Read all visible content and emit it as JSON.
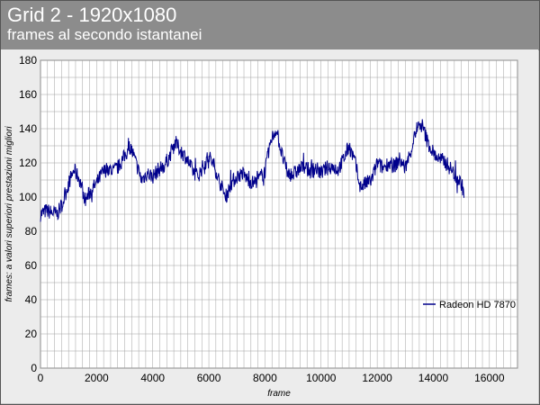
{
  "header": {
    "title": "Grid 2 - 1920x1080",
    "subtitle": "frames al secondo istantanei"
  },
  "colors": {
    "header_bg": "#8c8c8c",
    "plot_bg": "#ffffff",
    "grid": "#a0a0a0",
    "series": "#00008b"
  },
  "chart_data": {
    "type": "line",
    "title": "Grid 2 - 1920x1080",
    "subtitle": "frames al secondo istantanei",
    "xlabel": "frame",
    "ylabel": "frames: a valori superiori prestazioni migliori",
    "xlim": [
      0,
      17000
    ],
    "ylim": [
      0,
      180
    ],
    "xticks": [
      "0",
      "2000",
      "4000",
      "6000",
      "8000",
      "10000",
      "12000",
      "14000",
      "16000"
    ],
    "yticks": [
      "0",
      "20",
      "40",
      "60",
      "80",
      "100",
      "120",
      "140",
      "160",
      "180"
    ],
    "grid": true,
    "legend_position": "right",
    "series": [
      {
        "name": "Radeon HD 7870",
        "color": "#00008b",
        "x": [
          0,
          200,
          400,
          600,
          800,
          1000,
          1200,
          1400,
          1600,
          1800,
          2000,
          2200,
          2400,
          2600,
          2800,
          3000,
          3200,
          3400,
          3600,
          3800,
          4000,
          4200,
          4400,
          4600,
          4800,
          5000,
          5200,
          5400,
          5600,
          5800,
          6000,
          6200,
          6400,
          6600,
          6800,
          7000,
          7200,
          7400,
          7600,
          7800,
          8000,
          8200,
          8400,
          8600,
          8800,
          9000,
          9200,
          9400,
          9600,
          9800,
          10000,
          10200,
          10400,
          10600,
          10800,
          11000,
          11200,
          11400,
          11600,
          11800,
          12000,
          12200,
          12400,
          12600,
          12800,
          13000,
          13200,
          13400,
          13600,
          13800,
          14000,
          14200,
          14400,
          14600,
          14800,
          15000,
          15100
        ],
        "values": [
          90,
          92,
          91,
          90,
          97,
          108,
          116,
          110,
          98,
          104,
          108,
          114,
          117,
          115,
          118,
          124,
          130,
          120,
          110,
          114,
          112,
          116,
          118,
          124,
          132,
          127,
          123,
          116,
          112,
          118,
          124,
          118,
          108,
          100,
          108,
          112,
          114,
          110,
          108,
          111,
          115,
          132,
          140,
          125,
          114,
          113,
          116,
          118,
          115,
          117,
          114,
          117,
          118,
          116,
          122,
          130,
          121,
          106,
          108,
          110,
          120,
          117,
          120,
          118,
          122,
          117,
          127,
          140,
          142,
          132,
          126,
          122,
          121,
          117,
          112,
          108,
          102
        ]
      }
    ]
  }
}
